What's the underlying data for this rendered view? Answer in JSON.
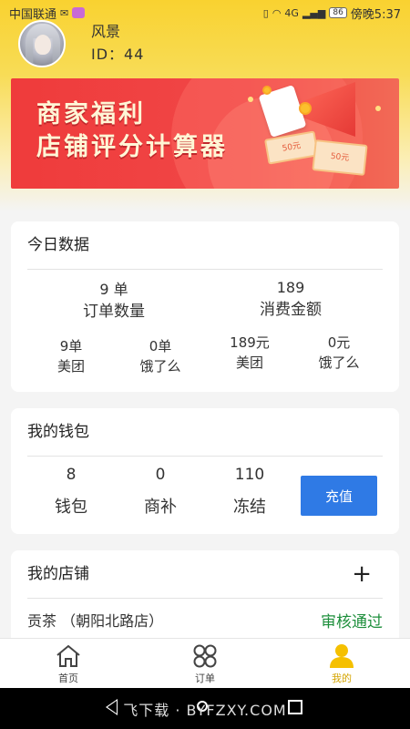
{
  "status_bar": {
    "carrier": "中国联通",
    "battery": "86",
    "time": "傍晚5:37",
    "signal_label": "4G"
  },
  "profile": {
    "name": "风景",
    "id_text": "ID：44"
  },
  "banner": {
    "line1": "商家福利",
    "line2": "店铺评分计算器",
    "coupon_small": "50元",
    "coupon_large": "50元"
  },
  "today": {
    "title": "今日数据",
    "orders_value": "9 单",
    "orders_label": "订单数量",
    "spend_value": "189",
    "spend_label": "消费金额",
    "breakdown": [
      {
        "value": "9单",
        "label": "美团"
      },
      {
        "value": "0单",
        "label": "饿了么"
      },
      {
        "value": "189元",
        "label": "美团"
      },
      {
        "value": "0元",
        "label": "饿了么"
      }
    ]
  },
  "wallet": {
    "title": "我的钱包",
    "items": [
      {
        "value": "8",
        "label": "钱包"
      },
      {
        "value": "0",
        "label": "商补"
      },
      {
        "value": "110",
        "label": "冻结"
      }
    ],
    "recharge_label": "充值"
  },
  "store": {
    "title": "我的店铺",
    "add_symbol": "+",
    "name": "贡茶 （朝阳北路店）",
    "status": "审核通过",
    "status_color": "#1e8f3c"
  },
  "tabbar": {
    "tabs": [
      {
        "label": "首页",
        "icon": "home-icon"
      },
      {
        "label": "订单",
        "icon": "grid-icon"
      },
      {
        "label": "我的",
        "icon": "user-icon",
        "active": true
      }
    ],
    "accent": "#f5c000"
  },
  "watermark": "飞下载 · BYFZXY.COM"
}
